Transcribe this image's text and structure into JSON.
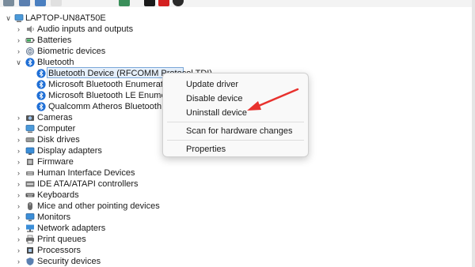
{
  "toolbar": {
    "icons": [
      "toolbar-properties-icon",
      "toolbar-help-icon",
      "toolbar-device-icon",
      "toolbar-update-driver-icon",
      "toolbar-disable-icon",
      "toolbar-uninstall-icon",
      "toolbar-scan-icon"
    ],
    "colors": [
      "#7a8c9c",
      "#5a7fb0",
      "#4a7fc0",
      "#3a8f5a",
      "#1a1a1a",
      "#d42020",
      "#2a2a2a"
    ]
  },
  "tree": {
    "root": "LAPTOP-UN8AT50E",
    "bluetooth_category": "Bluetooth",
    "categories_before": [
      {
        "label": "Audio inputs and outputs",
        "icon": "speaker-icon"
      },
      {
        "label": "Batteries",
        "icon": "battery-icon"
      },
      {
        "label": "Biometric devices",
        "icon": "fingerprint-icon"
      }
    ],
    "bluetooth_children": [
      {
        "label": "Bluetooth Device (RFCOMM Protocol TDI)",
        "selected": true
      },
      {
        "label": "Microsoft Bluetooth Enumerator"
      },
      {
        "label": "Microsoft Bluetooth LE Enumerator"
      },
      {
        "label": "Qualcomm Atheros Bluetooth"
      }
    ],
    "categories_after": [
      {
        "label": "Cameras",
        "icon": "camera-icon"
      },
      {
        "label": "Computer",
        "icon": "computer-icon"
      },
      {
        "label": "Disk drives",
        "icon": "disk-drive-icon"
      },
      {
        "label": "Display adapters",
        "icon": "display-adapter-icon"
      },
      {
        "label": "Firmware",
        "icon": "firmware-icon"
      },
      {
        "label": "Human Interface Devices",
        "icon": "hid-icon"
      },
      {
        "label": "IDE ATA/ATAPI controllers",
        "icon": "ide-controller-icon"
      },
      {
        "label": "Keyboards",
        "icon": "keyboard-icon"
      },
      {
        "label": "Mice and other pointing devices",
        "icon": "mouse-icon"
      },
      {
        "label": "Monitors",
        "icon": "monitor-icon"
      },
      {
        "label": "Network adapters",
        "icon": "network-adapter-icon"
      },
      {
        "label": "Print queues",
        "icon": "printer-icon"
      },
      {
        "label": "Processors",
        "icon": "processor-icon"
      },
      {
        "label": "Security devices",
        "icon": "security-device-icon"
      }
    ]
  },
  "context_menu": {
    "update_driver": "Update driver",
    "disable_device": "Disable device",
    "uninstall_device": "Uninstall device",
    "scan": "Scan for hardware changes",
    "properties": "Properties"
  },
  "annotation": {
    "arrow_color": "#e8322e",
    "points_to": "Uninstall device"
  },
  "colors": {
    "bluetooth": "#1f6fd6",
    "selection": "#e6f0fb",
    "selection_border": "#7aa7d8"
  }
}
